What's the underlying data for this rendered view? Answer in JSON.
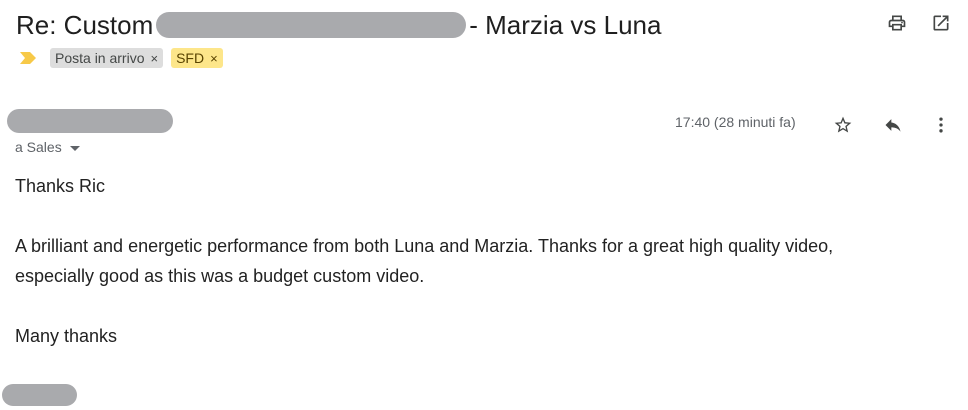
{
  "subject": {
    "prefix": "Re: Custom",
    "suffix": "- Marzia vs Luna"
  },
  "labels": {
    "inbox": "Posta in arrivo",
    "sfd": "SFD",
    "remove_glyph": "×"
  },
  "message": {
    "recipient": "a Sales",
    "time": "17:40 (28 minuti fa)",
    "body": {
      "greeting": "Thanks Ric",
      "line1": "A brilliant and energetic performance from both Luna and Marzia. Thanks for a great high quality video,",
      "line2": "especially good as this was a budget custom video.",
      "closing": "Many thanks"
    }
  },
  "icons": {
    "print": "print-icon",
    "open_new_window": "open-in-new-window-icon",
    "importance": "importance-marker-icon",
    "star": "star-icon",
    "reply": "reply-icon",
    "more": "more-vertical-icon",
    "recipient_dropdown": "chevron-down-icon"
  },
  "colors": {
    "importance_marker": "#f7c948",
    "sfd_label_bg": "#fde68a",
    "inbox_label_bg": "#dddddd",
    "redaction": "#a9aaad"
  }
}
